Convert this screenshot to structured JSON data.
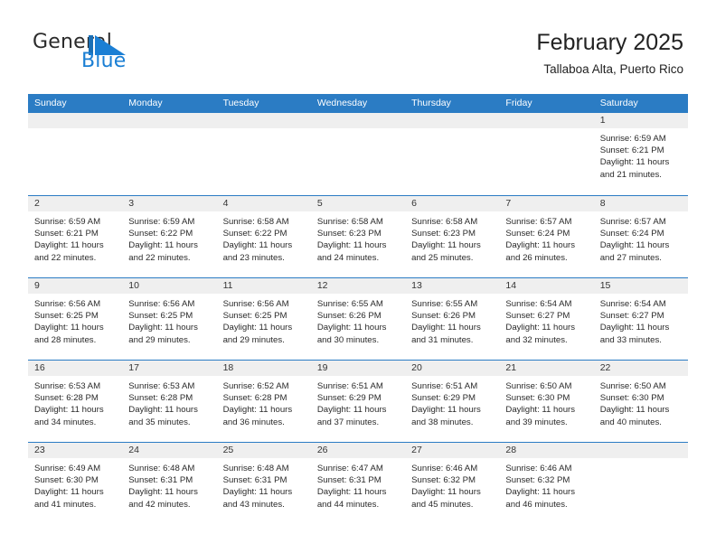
{
  "brand": {
    "name_part1": "General",
    "name_part2": "Blue",
    "accent_color": "#1b7fd4"
  },
  "header": {
    "title": "February 2025",
    "subtitle": "Tallaboa Alta, Puerto Rico"
  },
  "theme": {
    "header_blue": "#2b7cc4",
    "day_band_gray": "#efefef",
    "text": "#2a2a2a"
  },
  "weekdays": [
    "Sunday",
    "Monday",
    "Tuesday",
    "Wednesday",
    "Thursday",
    "Friday",
    "Saturday"
  ],
  "weeks": [
    [
      {
        "day": "",
        "empty": true
      },
      {
        "day": "",
        "empty": true
      },
      {
        "day": "",
        "empty": true
      },
      {
        "day": "",
        "empty": true
      },
      {
        "day": "",
        "empty": true
      },
      {
        "day": "",
        "empty": true
      },
      {
        "day": "1",
        "sunrise": "Sunrise: 6:59 AM",
        "sunset": "Sunset: 6:21 PM",
        "daylight1": "Daylight: 11 hours",
        "daylight2": "and 21 minutes."
      }
    ],
    [
      {
        "day": "2",
        "sunrise": "Sunrise: 6:59 AM",
        "sunset": "Sunset: 6:21 PM",
        "daylight1": "Daylight: 11 hours",
        "daylight2": "and 22 minutes."
      },
      {
        "day": "3",
        "sunrise": "Sunrise: 6:59 AM",
        "sunset": "Sunset: 6:22 PM",
        "daylight1": "Daylight: 11 hours",
        "daylight2": "and 22 minutes."
      },
      {
        "day": "4",
        "sunrise": "Sunrise: 6:58 AM",
        "sunset": "Sunset: 6:22 PM",
        "daylight1": "Daylight: 11 hours",
        "daylight2": "and 23 minutes."
      },
      {
        "day": "5",
        "sunrise": "Sunrise: 6:58 AM",
        "sunset": "Sunset: 6:23 PM",
        "daylight1": "Daylight: 11 hours",
        "daylight2": "and 24 minutes."
      },
      {
        "day": "6",
        "sunrise": "Sunrise: 6:58 AM",
        "sunset": "Sunset: 6:23 PM",
        "daylight1": "Daylight: 11 hours",
        "daylight2": "and 25 minutes."
      },
      {
        "day": "7",
        "sunrise": "Sunrise: 6:57 AM",
        "sunset": "Sunset: 6:24 PM",
        "daylight1": "Daylight: 11 hours",
        "daylight2": "and 26 minutes."
      },
      {
        "day": "8",
        "sunrise": "Sunrise: 6:57 AM",
        "sunset": "Sunset: 6:24 PM",
        "daylight1": "Daylight: 11 hours",
        "daylight2": "and 27 minutes."
      }
    ],
    [
      {
        "day": "9",
        "sunrise": "Sunrise: 6:56 AM",
        "sunset": "Sunset: 6:25 PM",
        "daylight1": "Daylight: 11 hours",
        "daylight2": "and 28 minutes."
      },
      {
        "day": "10",
        "sunrise": "Sunrise: 6:56 AM",
        "sunset": "Sunset: 6:25 PM",
        "daylight1": "Daylight: 11 hours",
        "daylight2": "and 29 minutes."
      },
      {
        "day": "11",
        "sunrise": "Sunrise: 6:56 AM",
        "sunset": "Sunset: 6:25 PM",
        "daylight1": "Daylight: 11 hours",
        "daylight2": "and 29 minutes."
      },
      {
        "day": "12",
        "sunrise": "Sunrise: 6:55 AM",
        "sunset": "Sunset: 6:26 PM",
        "daylight1": "Daylight: 11 hours",
        "daylight2": "and 30 minutes."
      },
      {
        "day": "13",
        "sunrise": "Sunrise: 6:55 AM",
        "sunset": "Sunset: 6:26 PM",
        "daylight1": "Daylight: 11 hours",
        "daylight2": "and 31 minutes."
      },
      {
        "day": "14",
        "sunrise": "Sunrise: 6:54 AM",
        "sunset": "Sunset: 6:27 PM",
        "daylight1": "Daylight: 11 hours",
        "daylight2": "and 32 minutes."
      },
      {
        "day": "15",
        "sunrise": "Sunrise: 6:54 AM",
        "sunset": "Sunset: 6:27 PM",
        "daylight1": "Daylight: 11 hours",
        "daylight2": "and 33 minutes."
      }
    ],
    [
      {
        "day": "16",
        "sunrise": "Sunrise: 6:53 AM",
        "sunset": "Sunset: 6:28 PM",
        "daylight1": "Daylight: 11 hours",
        "daylight2": "and 34 minutes."
      },
      {
        "day": "17",
        "sunrise": "Sunrise: 6:53 AM",
        "sunset": "Sunset: 6:28 PM",
        "daylight1": "Daylight: 11 hours",
        "daylight2": "and 35 minutes."
      },
      {
        "day": "18",
        "sunrise": "Sunrise: 6:52 AM",
        "sunset": "Sunset: 6:28 PM",
        "daylight1": "Daylight: 11 hours",
        "daylight2": "and 36 minutes."
      },
      {
        "day": "19",
        "sunrise": "Sunrise: 6:51 AM",
        "sunset": "Sunset: 6:29 PM",
        "daylight1": "Daylight: 11 hours",
        "daylight2": "and 37 minutes."
      },
      {
        "day": "20",
        "sunrise": "Sunrise: 6:51 AM",
        "sunset": "Sunset: 6:29 PM",
        "daylight1": "Daylight: 11 hours",
        "daylight2": "and 38 minutes."
      },
      {
        "day": "21",
        "sunrise": "Sunrise: 6:50 AM",
        "sunset": "Sunset: 6:30 PM",
        "daylight1": "Daylight: 11 hours",
        "daylight2": "and 39 minutes."
      },
      {
        "day": "22",
        "sunrise": "Sunrise: 6:50 AM",
        "sunset": "Sunset: 6:30 PM",
        "daylight1": "Daylight: 11 hours",
        "daylight2": "and 40 minutes."
      }
    ],
    [
      {
        "day": "23",
        "sunrise": "Sunrise: 6:49 AM",
        "sunset": "Sunset: 6:30 PM",
        "daylight1": "Daylight: 11 hours",
        "daylight2": "and 41 minutes."
      },
      {
        "day": "24",
        "sunrise": "Sunrise: 6:48 AM",
        "sunset": "Sunset: 6:31 PM",
        "daylight1": "Daylight: 11 hours",
        "daylight2": "and 42 minutes."
      },
      {
        "day": "25",
        "sunrise": "Sunrise: 6:48 AM",
        "sunset": "Sunset: 6:31 PM",
        "daylight1": "Daylight: 11 hours",
        "daylight2": "and 43 minutes."
      },
      {
        "day": "26",
        "sunrise": "Sunrise: 6:47 AM",
        "sunset": "Sunset: 6:31 PM",
        "daylight1": "Daylight: 11 hours",
        "daylight2": "and 44 minutes."
      },
      {
        "day": "27",
        "sunrise": "Sunrise: 6:46 AM",
        "sunset": "Sunset: 6:32 PM",
        "daylight1": "Daylight: 11 hours",
        "daylight2": "and 45 minutes."
      },
      {
        "day": "28",
        "sunrise": "Sunrise: 6:46 AM",
        "sunset": "Sunset: 6:32 PM",
        "daylight1": "Daylight: 11 hours",
        "daylight2": "and 46 minutes."
      },
      {
        "day": "",
        "empty": true
      }
    ]
  ]
}
